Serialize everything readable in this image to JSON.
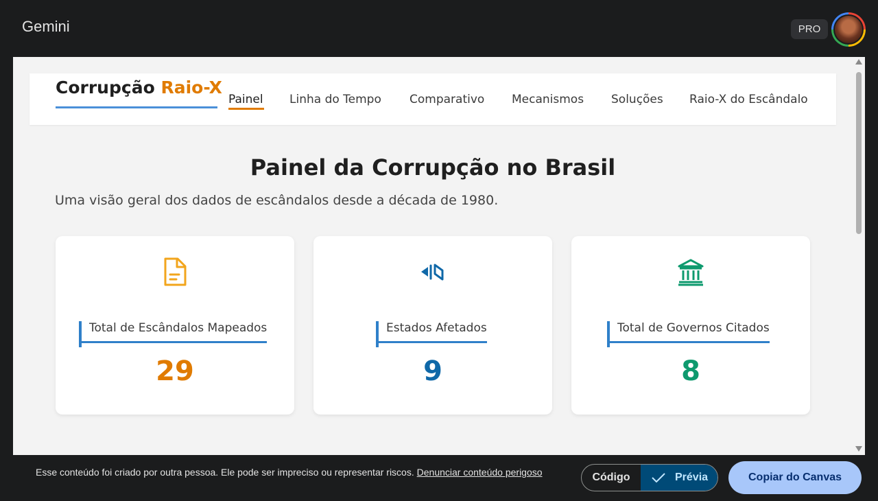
{
  "topbar": {
    "app_title": "Gemini",
    "pro_badge": "PRO"
  },
  "app": {
    "brand_main": "Corrupção",
    "brand_accent": "Raio-X",
    "nav": [
      {
        "label": "Painel",
        "active": true
      },
      {
        "label": "Linha do Tempo",
        "active": false
      },
      {
        "label": "Comparativo",
        "active": false
      },
      {
        "label": "Mecanismos",
        "active": false
      },
      {
        "label": "Soluções",
        "active": false
      },
      {
        "label": "Raio-X do Escândalo",
        "active": false
      }
    ],
    "page_title": "Painel da Corrupção no Brasil",
    "page_subtitle": "Uma visão geral dos dados de escândalos desde a década de 1980.",
    "cards": [
      {
        "icon": "document-icon",
        "label": "Total de Escândalos Mapeados",
        "value": "29",
        "color": "#e07b00"
      },
      {
        "icon": "map-icon",
        "label": "Estados Afetados",
        "value": "9",
        "color": "#0f68a8"
      },
      {
        "icon": "government-building-icon",
        "label": "Total de Governos Citados",
        "value": "8",
        "color": "#0e9a6e"
      }
    ]
  },
  "bottombar": {
    "notice_text": "Esse conteúdo foi criado por outra pessoa. Ele pode ser impreciso ou representar riscos.",
    "report_link": "Denunciar conteúdo perigoso",
    "code_label": "Código",
    "preview_label": "Prévia",
    "copy_label": "Copiar do Canvas"
  },
  "colors": {
    "accent_orange": "#e07b00",
    "accent_blue": "#2f80c9",
    "accent_green": "#0e9a6e",
    "preview_bg": "#004a77",
    "copy_bg": "#a8c7fa"
  }
}
